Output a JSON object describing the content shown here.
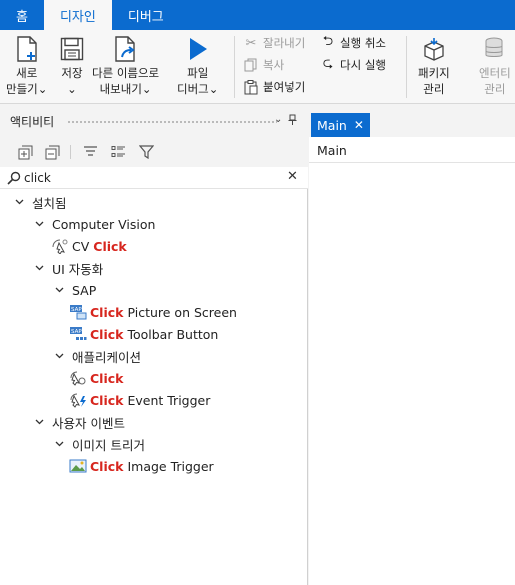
{
  "menubar": {
    "tabs": [
      {
        "label": "홈",
        "active": false
      },
      {
        "label": "디자인",
        "active": true
      },
      {
        "label": "디버그",
        "active": false
      }
    ]
  },
  "ribbon": {
    "new": {
      "line1": "새로",
      "line2": "만들기⌄",
      "icon": "new-file-icon"
    },
    "save": {
      "line1": "저장",
      "line2": "⌄",
      "icon": "save-icon"
    },
    "export": {
      "line1": "다른 이름으로",
      "line2": "내보내기⌄",
      "icon": "export-icon"
    },
    "debug_file": {
      "line1": "파일",
      "line2": "디버그⌄",
      "icon": "play-icon"
    },
    "cut": "잘라내기",
    "copy": "복사",
    "paste": "붙여넣기",
    "undo": "실행 취소",
    "redo": "다시 실행",
    "packages": {
      "line1": "패키지",
      "line2": "관리",
      "icon": "package-icon"
    },
    "entities": {
      "line1": "엔터티",
      "line2": "관리",
      "icon": "database-icon"
    }
  },
  "activities_panel": {
    "title": "액티비티",
    "search": {
      "value": "click",
      "placeholder": ""
    },
    "tree": [
      {
        "level": 0,
        "label": "설치됨",
        "type": "group"
      },
      {
        "level": 1,
        "label": "Computer Vision",
        "type": "group"
      },
      {
        "level": 2,
        "prefix": "CV",
        "highlight": "Click",
        "rest": "",
        "type": "activity",
        "icon": "cv-click-icon"
      },
      {
        "level": 1,
        "label": "UI 자동화",
        "type": "group"
      },
      {
        "level": 2,
        "label": "SAP",
        "type": "group"
      },
      {
        "level": 3,
        "prefix": "",
        "highlight": "Click",
        "rest": "Picture on Screen",
        "type": "activity",
        "icon": "sap-picture-icon"
      },
      {
        "level": 3,
        "prefix": "",
        "highlight": "Click",
        "rest": "Toolbar Button",
        "type": "activity",
        "icon": "sap-toolbar-icon"
      },
      {
        "level": 2,
        "label": "애플리케이션",
        "type": "group"
      },
      {
        "level": 3,
        "prefix": "",
        "highlight": "Click",
        "rest": "",
        "type": "activity",
        "icon": "click-icon"
      },
      {
        "level": 3,
        "prefix": "",
        "highlight": "Click",
        "rest": "Event Trigger",
        "type": "activity",
        "icon": "click-trigger-icon"
      },
      {
        "level": 1,
        "label": "사용자 이벤트",
        "type": "group"
      },
      {
        "level": 2,
        "label": "이미지 트리거",
        "type": "group"
      },
      {
        "level": 3,
        "prefix": "",
        "highlight": "Click",
        "rest": "Image Trigger",
        "type": "activity",
        "icon": "image-trigger-icon"
      }
    ]
  },
  "designer": {
    "tab_label": "Main",
    "breadcrumb": "Main"
  },
  "colors": {
    "accent": "#0b6bcf",
    "highlight": "#d7261e"
  }
}
